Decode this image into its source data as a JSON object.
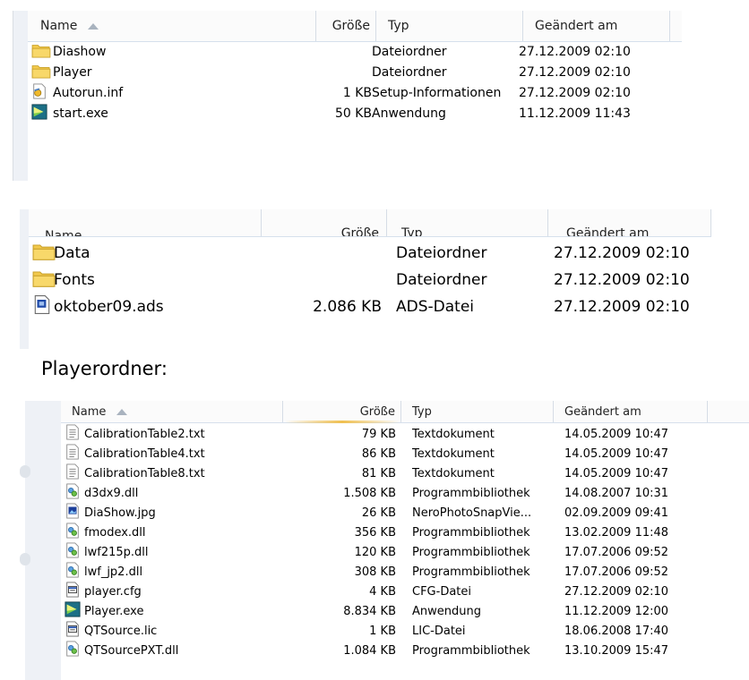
{
  "panel1": {
    "headers": {
      "name": "Name",
      "size": "Größe",
      "type": "Typ",
      "date": "Geändert am"
    },
    "rows": [
      {
        "name": "Diashow",
        "size": "",
        "type": "Dateiordner",
        "date": "27.12.2009 02:10",
        "icon": "folder-icon"
      },
      {
        "name": "Player",
        "size": "",
        "type": "Dateiordner",
        "date": "27.12.2009 02:10",
        "icon": "folder-icon"
      },
      {
        "name": "Autorun.inf",
        "size": "1 KB",
        "type": "Setup-Informationen",
        "date": "27.12.2009 02:10",
        "icon": "setup-file-icon"
      },
      {
        "name": "start.exe",
        "size": "50 KB",
        "type": "Anwendung",
        "date": "11.12.2009 11:43",
        "icon": "app-icon"
      }
    ]
  },
  "panel2": {
    "headers": {
      "name": "Name",
      "size": "Größe",
      "type": "Typ",
      "date": "Geändert am"
    },
    "rows": [
      {
        "name": "Data",
        "size": "",
        "type": "Dateiordner",
        "date": "27.12.2009 02:10",
        "icon": "folder-icon"
      },
      {
        "name": "Fonts",
        "size": "",
        "type": "Dateiordner",
        "date": "27.12.2009 02:10",
        "icon": "folder-icon"
      },
      {
        "name": "oktober09.ads",
        "size": "2.086 KB",
        "type": "ADS-Datei",
        "date": "27.12.2009 02:10",
        "icon": "ads-file-icon"
      }
    ]
  },
  "caption": "Playerordner:",
  "panel3": {
    "headers": {
      "name": "Name",
      "size": "Größe",
      "type": "Typ",
      "date": "Geändert am"
    },
    "rows": [
      {
        "name": "CalibrationTable2.txt",
        "size": "79 KB",
        "type": "Textdokument",
        "date": "14.05.2009 10:47",
        "icon": "text-file-icon"
      },
      {
        "name": "CalibrationTable4.txt",
        "size": "86 KB",
        "type": "Textdokument",
        "date": "14.05.2009 10:47",
        "icon": "text-file-icon"
      },
      {
        "name": "CalibrationTable8.txt",
        "size": "81 KB",
        "type": "Textdokument",
        "date": "14.05.2009 10:47",
        "icon": "text-file-icon"
      },
      {
        "name": "d3dx9.dll",
        "size": "1.508 KB",
        "type": "Programmbibliothek",
        "date": "14.08.2007 10:31",
        "icon": "dll-file-icon"
      },
      {
        "name": "DiaShow.jpg",
        "size": "26 KB",
        "type": "NeroPhotoSnapVie...",
        "date": "02.09.2009 09:41",
        "icon": "image-file-icon"
      },
      {
        "name": "fmodex.dll",
        "size": "356 KB",
        "type": "Programmbibliothek",
        "date": "13.02.2009 11:48",
        "icon": "dll-file-icon"
      },
      {
        "name": "lwf215p.dll",
        "size": "120 KB",
        "type": "Programmbibliothek",
        "date": "17.07.2006 09:52",
        "icon": "dll-file-icon"
      },
      {
        "name": "lwf_jp2.dll",
        "size": "308 KB",
        "type": "Programmbibliothek",
        "date": "17.07.2006 09:52",
        "icon": "dll-file-icon"
      },
      {
        "name": "player.cfg",
        "size": "4 KB",
        "type": "CFG-Datei",
        "date": "27.12.2009 02:10",
        "icon": "cfg-file-icon"
      },
      {
        "name": "Player.exe",
        "size": "8.834 KB",
        "type": "Anwendung",
        "date": "11.12.2009 12:00",
        "icon": "app-icon"
      },
      {
        "name": "QTSource.lic",
        "size": "1 KB",
        "type": "LIC-Datei",
        "date": "18.06.2008 17:40",
        "icon": "cfg-file-icon"
      },
      {
        "name": "QTSourcePXT.dll",
        "size": "1.084 KB",
        "type": "Programmbibliothek",
        "date": "13.10.2009 15:47",
        "icon": "dll-file-icon"
      }
    ]
  }
}
